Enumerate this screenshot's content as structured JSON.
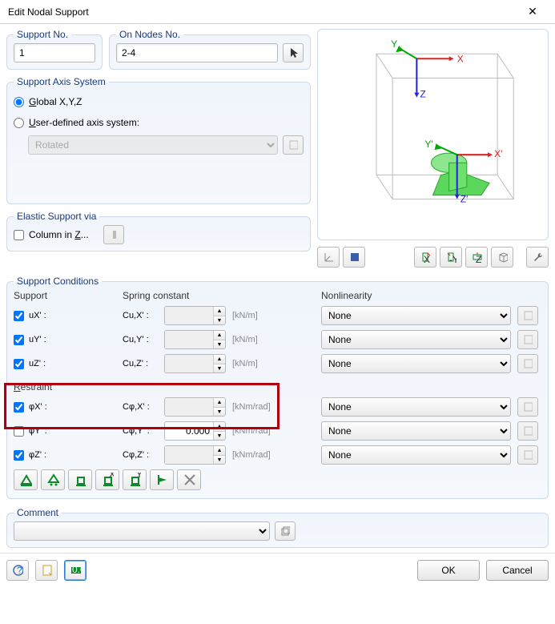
{
  "title": "Edit Nodal Support",
  "panels": {
    "support_no": "Support No.",
    "on_nodes": "On Nodes No.",
    "axis": "Support Axis System",
    "elastic": "Elastic Support via",
    "conditions": "Support Conditions",
    "comment": "Comment"
  },
  "support_no_value": "1",
  "on_nodes_value": "2-4",
  "axis": {
    "global_label_pre": "",
    "global_label_letter": "G",
    "global_label_rest": "lobal X,Y,Z",
    "user_label_letter": "U",
    "user_label_rest": "ser-defined axis system:",
    "rotated_option": "Rotated"
  },
  "elastic": {
    "column_pre": "Column in ",
    "column_letter": "Z",
    "column_rest": "..."
  },
  "headers": {
    "support": "Support",
    "spring": "Spring constant",
    "nonlin": "Nonlinearity",
    "restraint_letter": "R",
    "restraint_rest": "estraint"
  },
  "rows": {
    "ux": {
      "label": "uX' :",
      "spring_label": "Cu,X' :",
      "unit": "[kN/m]",
      "nonlin": "None",
      "value": "",
      "checked": true,
      "spring_enabled": false
    },
    "uy": {
      "label": "uY' :",
      "spring_label": "Cu,Y' :",
      "unit": "[kN/m]",
      "nonlin": "None",
      "value": "",
      "checked": true,
      "spring_enabled": false
    },
    "uz": {
      "label": "uZ' :",
      "spring_label": "Cu,Z' :",
      "unit": "[kN/m]",
      "nonlin": "None",
      "value": "",
      "checked": true,
      "spring_enabled": false
    },
    "phx": {
      "label": "φX' :",
      "spring_label": "Cφ,X' :",
      "unit": "[kNm/rad]",
      "nonlin": "None",
      "value": "",
      "checked": true,
      "spring_enabled": false
    },
    "phy": {
      "label": "φY' :",
      "spring_label": "Cφ,Y' :",
      "unit": "[kNm/rad]",
      "nonlin": "None",
      "value": "0.000",
      "checked": false,
      "spring_enabled": true
    },
    "phz": {
      "label": "φZ' :",
      "spring_label": "Cφ,Z' :",
      "unit": "[kNm/rad]",
      "nonlin": "None",
      "value": "",
      "checked": true,
      "spring_enabled": false
    }
  },
  "buttons": {
    "ok": "OK",
    "cancel": "Cancel"
  },
  "comment_value": ""
}
